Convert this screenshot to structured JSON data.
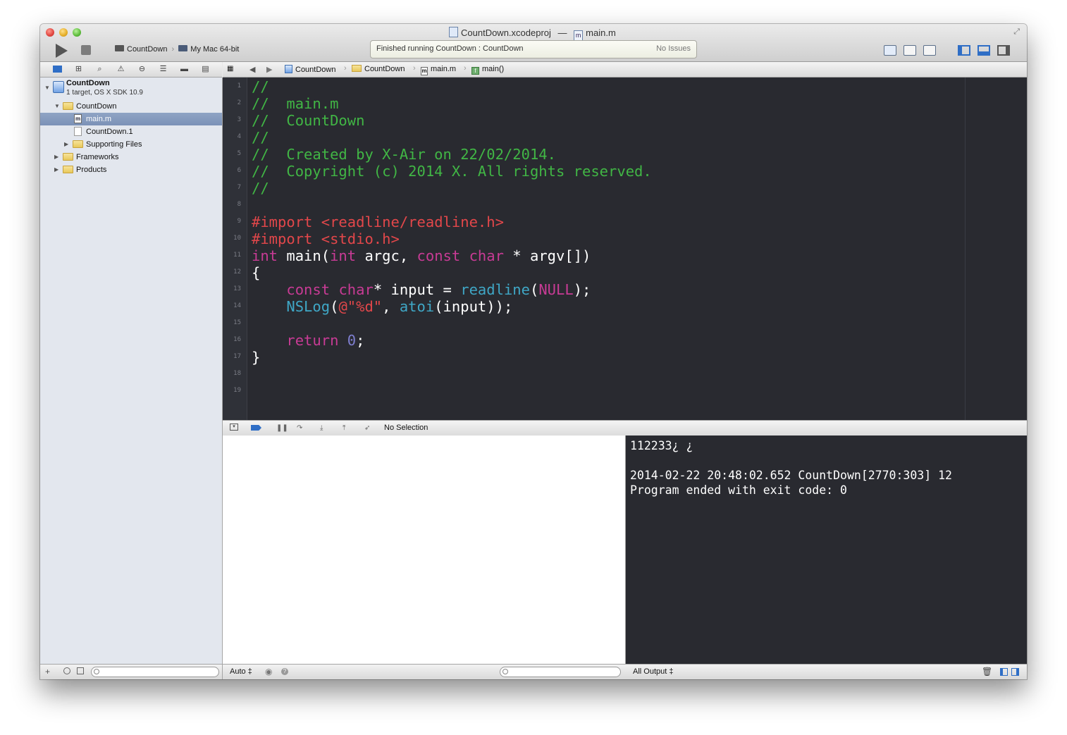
{
  "window": {
    "title_project": "CountDown.xcodeproj",
    "title_sep": "—",
    "title_file": "main.m"
  },
  "toolbar": {
    "scheme": "CountDown",
    "destination": "My Mac 64-bit",
    "activity_message": "Finished running CountDown : CountDown",
    "issues": "No Issues"
  },
  "navigator": {
    "project_name": "CountDown",
    "project_subtitle": "1 target, OS X SDK 10.9",
    "items": [
      {
        "label": "CountDown",
        "kind": "folder",
        "expanded": true
      },
      {
        "label": "main.m",
        "kind": "source-file",
        "selected": true
      },
      {
        "label": "CountDown.1",
        "kind": "file"
      },
      {
        "label": "Supporting Files",
        "kind": "folder",
        "expanded": false
      },
      {
        "label": "Frameworks",
        "kind": "folder",
        "expanded": false
      },
      {
        "label": "Products",
        "kind": "folder",
        "expanded": false
      }
    ]
  },
  "jumpbar": {
    "crumbs": [
      "CountDown",
      "CountDown",
      "main.m",
      "main()"
    ]
  },
  "editor": {
    "line_numbers": [
      "1",
      "2",
      "3",
      "4",
      "5",
      "6",
      "7",
      "8",
      "9",
      "10",
      "11",
      "12",
      "13",
      "14",
      "15",
      "16",
      "17",
      "18",
      "19"
    ],
    "lines": [
      "//",
      "//  main.m",
      "//  CountDown",
      "//",
      "//  Created by X-Air on 22/02/2014.",
      "//  Copyright (c) 2014 X. All rights reserved.",
      "//",
      "",
      "#import <readline/readline.h>",
      "#import <stdio.h>",
      "int main(int argc, const char * argv[])",
      "{",
      "    const char* input = readline(NULL);",
      "    NSLog(@\"%d\", atoi(input));",
      "",
      "    return 0;",
      "}",
      "",
      ""
    ],
    "tokens": {
      "import_kw": "#import",
      "readline_h": "<readline/readline.h>",
      "stdio_h": "<stdio.h>",
      "int": "int",
      "main": "main(",
      "argc": " argc, ",
      "const": "const",
      "char": "char",
      "argv": " * argv[])",
      "brace_open": "{",
      "input_assign": "* input = ",
      "readline_fn": "readline",
      "paren_open": "(",
      "null": "NULL",
      "paren_close_semi": ");",
      "nslog": "NSLog",
      "fmt": "@\"%d\"",
      "comma": ", ",
      "atoi": "atoi",
      "atoi_args": "(input));",
      "return": "return",
      "zero": "0",
      "semi": ";",
      "brace_close": "}"
    },
    "colors": {
      "background": "#292a30",
      "comment": "#41b645",
      "preprocessor": "#e2474a",
      "keyword": "#c83b95",
      "function": "#3fa7c6",
      "number": "#7e7ecf"
    }
  },
  "debugbar": {
    "selection": "No Selection"
  },
  "variables": {
    "scope": "Auto ‡"
  },
  "console": {
    "lines": [
      "112233¿ ¿",
      "",
      "2014-02-22 20:48:02.652 CountDown[2770:303] 12",
      "Program ended with exit code: 0"
    ],
    "output_filter": "All Output ‡"
  }
}
